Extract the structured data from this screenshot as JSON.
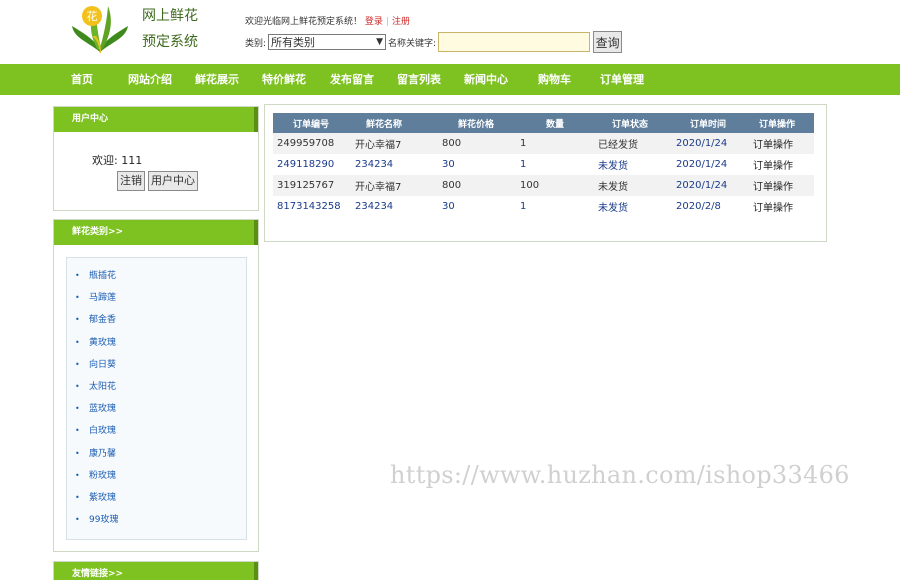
{
  "header": {
    "site_name_line1": "网上鲜花",
    "site_name_line2": "预定系统",
    "logo_text": "花",
    "welcome_text": "欢迎光临网上鲜花预定系统！",
    "login_link": "登录",
    "register_link": "注册",
    "category_label": "类别:",
    "category_selected": "所有类别",
    "keyword_label": "名称关键字:",
    "keyword_value": "",
    "search_button": "查询"
  },
  "nav": {
    "items": [
      {
        "label": "首页"
      },
      {
        "label": "网站介绍"
      },
      {
        "label": "鲜花展示"
      },
      {
        "label": "特价鲜花"
      },
      {
        "label": "发布留言"
      },
      {
        "label": "留言列表"
      },
      {
        "label": "新闻中心"
      },
      {
        "label": "购物车"
      },
      {
        "label": "订单管理"
      }
    ]
  },
  "user_center": {
    "title": "用户中心",
    "welcome": "欢迎: 111",
    "logout_button": "注销",
    "center_button": "用户中心"
  },
  "categories": {
    "title": "鲜花类别>>",
    "items": [
      "瓶插花",
      "马蹄莲",
      "郁金香",
      "黄玫瑰",
      "向日葵",
      "太阳花",
      "蓝玫瑰",
      "白玫瑰",
      "康乃馨",
      "粉玫瑰",
      "紫玫瑰",
      "99玫瑰"
    ]
  },
  "links": {
    "title": "友情链接>>"
  },
  "orders": {
    "columns": [
      "订单编号",
      "鲜花名称",
      "鲜花价格",
      "数量",
      "订单状态",
      "订单时间",
      "订单操作"
    ],
    "rows": [
      [
        "249959708",
        "开心幸福7",
        "800",
        "1",
        "已经发货",
        "2020/1/24",
        "订单操作"
      ],
      [
        "249118290",
        "234234",
        "30",
        "1",
        "未发货",
        "2020/1/24",
        "订单操作"
      ],
      [
        "319125767",
        "开心幸福7",
        "800",
        "100",
        "未发货",
        "2020/1/24",
        "订单操作"
      ],
      [
        "8173143258",
        "234234",
        "30",
        "1",
        "未发货",
        "2020/2/8",
        "订单操作"
      ]
    ]
  },
  "watermark": "https://www.huzhan.com/ishop33466",
  "colors": {
    "nav_green": "#7ec221",
    "table_header": "#5f7e9c",
    "link_blue": "#1b5db3",
    "auth_link_red": "#cc2a2a"
  }
}
